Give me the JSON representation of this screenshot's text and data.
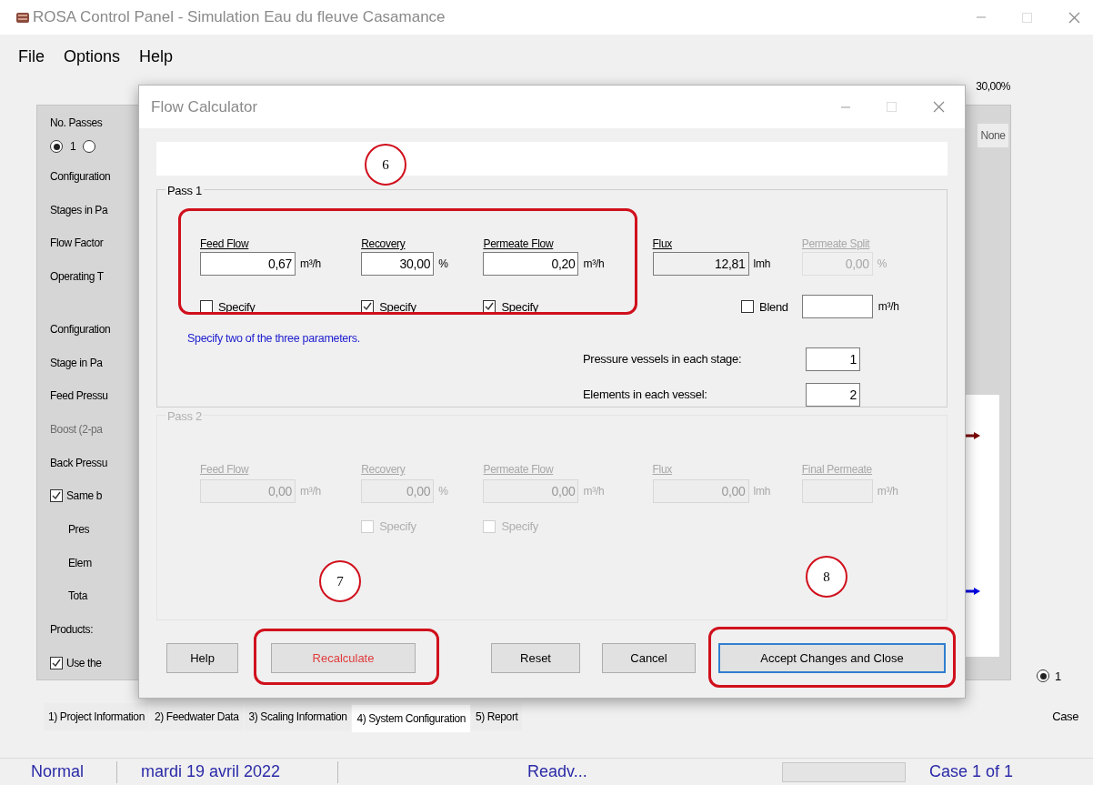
{
  "window": {
    "title": "ROSA Control Panel - Simulation Eau du fleuve Casamance"
  },
  "menu": [
    "File",
    "Options",
    "Help"
  ],
  "background": {
    "recovery_reading": "30,00%",
    "none_label": "None",
    "passes": {
      "label": "No. Passes",
      "options": [
        {
          "label": "1",
          "selected": true
        },
        {
          "selected": false
        }
      ]
    },
    "labels": [
      {
        "kind": "label",
        "text": "Configuration"
      },
      {
        "kind": "label",
        "text": "Stages in Pa"
      },
      {
        "kind": "label",
        "text": "Flow Factor"
      },
      {
        "kind": "label",
        "text": "Operating T"
      },
      {
        "kind": "gap"
      },
      {
        "kind": "label",
        "text": "Configuration"
      },
      {
        "kind": "label",
        "text": "Stage in Pa"
      },
      {
        "kind": "label",
        "text": "Feed Pressu"
      },
      {
        "kind": "disabled",
        "text": "Boost (2-pa"
      },
      {
        "kind": "label",
        "text": "Back Pressu"
      },
      {
        "kind": "checkbox",
        "text": "Same b",
        "checked": true
      },
      {
        "kind": "sublabel",
        "text": "Pres"
      },
      {
        "kind": "sublabel",
        "text": "Elem"
      },
      {
        "kind": "sublabel",
        "text": "Tota"
      },
      {
        "kind": "label",
        "text": "Products:"
      },
      {
        "kind": "checkbox",
        "text": "Use the",
        "checked": true
      }
    ],
    "case_option": {
      "label": "1",
      "selected": true
    },
    "case_label": "Case"
  },
  "tabs": [
    {
      "label": "1) Project Information",
      "selected": false
    },
    {
      "label": "2) Feedwater Data",
      "selected": false
    },
    {
      "label": "3) Scaling Information",
      "selected": false
    },
    {
      "label": "4) System Configuration",
      "selected": true
    },
    {
      "label": "5) Report",
      "selected": false
    }
  ],
  "status_bar": {
    "mode": "Normal",
    "date": "mardi 19 avril 2022",
    "message": "Readv...",
    "case": "Case 1 of 1"
  },
  "dialog": {
    "title": "Flow Calculator",
    "pass1": {
      "title": "Pass 1",
      "disabled": false,
      "columns": [
        {
          "kind": "input",
          "header": "Feed Flow",
          "value": "0,67",
          "unit": "m³/h",
          "specify": {
            "label": "Specify",
            "checked": false
          }
        },
        {
          "kind": "input",
          "header": "Recovery",
          "value": "30,00",
          "unit": "%",
          "specify": {
            "label": "Specify",
            "checked": true
          }
        },
        {
          "kind": "input",
          "header": "Permeate Flow",
          "value": "0,20",
          "unit": "m³/h",
          "specify": {
            "label": "Specify",
            "checked": true
          }
        },
        {
          "kind": "readonly",
          "header": "Flux",
          "value": "12,81",
          "unit": "lmh"
        },
        {
          "kind": "disabled",
          "header": "Permeate Split",
          "value": "0,00",
          "unit": "%"
        }
      ],
      "blend": {
        "label": "Blend",
        "checked": false,
        "unit": "m³/h"
      },
      "hint": "Specify two of the three parameters.",
      "vessels": [
        {
          "label": "Pressure vessels in each stage:",
          "value": "1"
        },
        {
          "label": "Elements in each vessel:",
          "value": "2"
        }
      ]
    },
    "pass2": {
      "title": "Pass 2",
      "disabled": true,
      "columns": [
        {
          "header": "Feed Flow",
          "value": "0,00",
          "unit": "m³/h"
        },
        {
          "header": "Recovery",
          "value": "0,00",
          "unit": "%",
          "specify": {
            "label": "Specify",
            "checked": false
          }
        },
        {
          "header": "Permeate Flow",
          "value": "0,00",
          "unit": "m³/h",
          "specify": {
            "label": "Specify",
            "checked": false
          }
        },
        {
          "header": "Flux",
          "value": "0,00",
          "unit": "lmh"
        },
        {
          "header": "Final Permeate",
          "unit": "m³/h"
        }
      ]
    },
    "buttons": [
      {
        "label": "Help",
        "kind": "normal"
      },
      {
        "label": "Recalculate",
        "kind": "warning"
      },
      {
        "label": "Reset",
        "kind": "normal"
      },
      {
        "label": "Cancel",
        "kind": "normal"
      },
      {
        "label": "Accept Changes and Close",
        "kind": "default"
      }
    ],
    "callouts": [
      "6",
      "7",
      "8"
    ]
  }
}
